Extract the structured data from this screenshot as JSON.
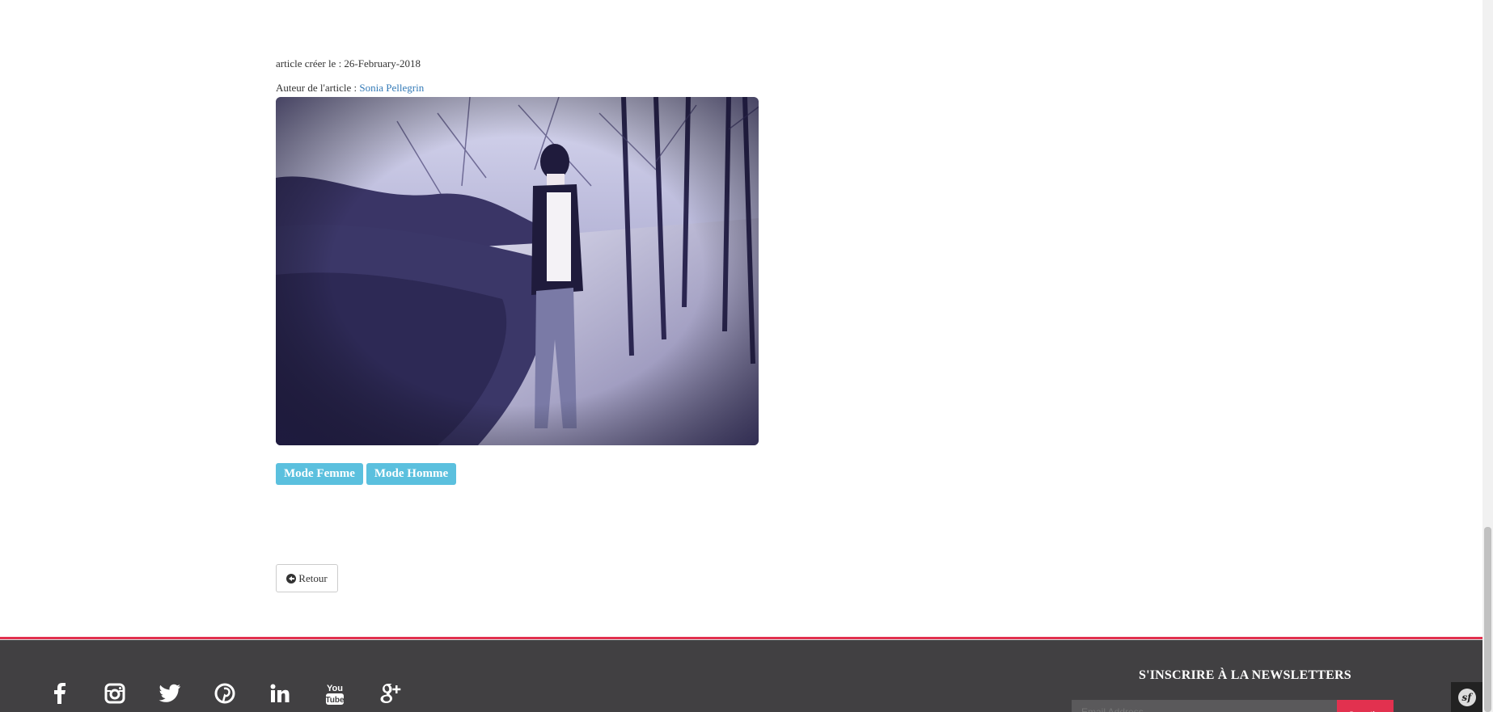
{
  "article": {
    "date_label": "article créer le : 26-February-2018",
    "author_prefix": "Auteur de l'article : ",
    "author_name": "Sonia Pellegrin",
    "tags": [
      "Mode Femme",
      "Mode Homme"
    ],
    "back_label": "Retour"
  },
  "footer": {
    "social_icons": [
      "facebook-icon",
      "instagram-icon",
      "twitter-icon",
      "pinterest-icon",
      "linkedin-icon",
      "youtube-icon",
      "google-plus-icon"
    ],
    "newsletter_title": "S'INSCRIRE À LA NEWSLETTERS",
    "email_placeholder": "Email Address",
    "subscribe_label": "Suscribe",
    "accent_color": "#e2314f",
    "background_color": "#414042"
  },
  "toolbar": {
    "symfony_logo": "sf"
  },
  "colors": {
    "tag_background": "#5bc0de",
    "link": "#337ab7"
  }
}
